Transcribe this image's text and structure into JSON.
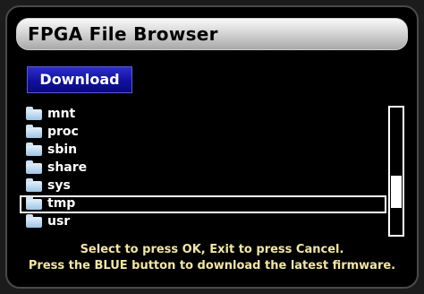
{
  "window": {
    "title": "FPGA File Browser"
  },
  "toolbar": {
    "download_label": "Download"
  },
  "files": [
    {
      "name": "mnt",
      "selected": false
    },
    {
      "name": "proc",
      "selected": false
    },
    {
      "name": "sbin",
      "selected": false
    },
    {
      "name": "share",
      "selected": false
    },
    {
      "name": "sys",
      "selected": false
    },
    {
      "name": "tmp",
      "selected": true
    },
    {
      "name": "usr",
      "selected": false
    }
  ],
  "footer": {
    "line1": "Select to press OK, Exit to press Cancel.",
    "line2": "Press the BLUE button to download the latest firmware."
  },
  "icons": {
    "folder": "folder-icon"
  },
  "colors": {
    "button_blue": "#1a1ab4",
    "footer_text": "#f2e6a0"
  }
}
